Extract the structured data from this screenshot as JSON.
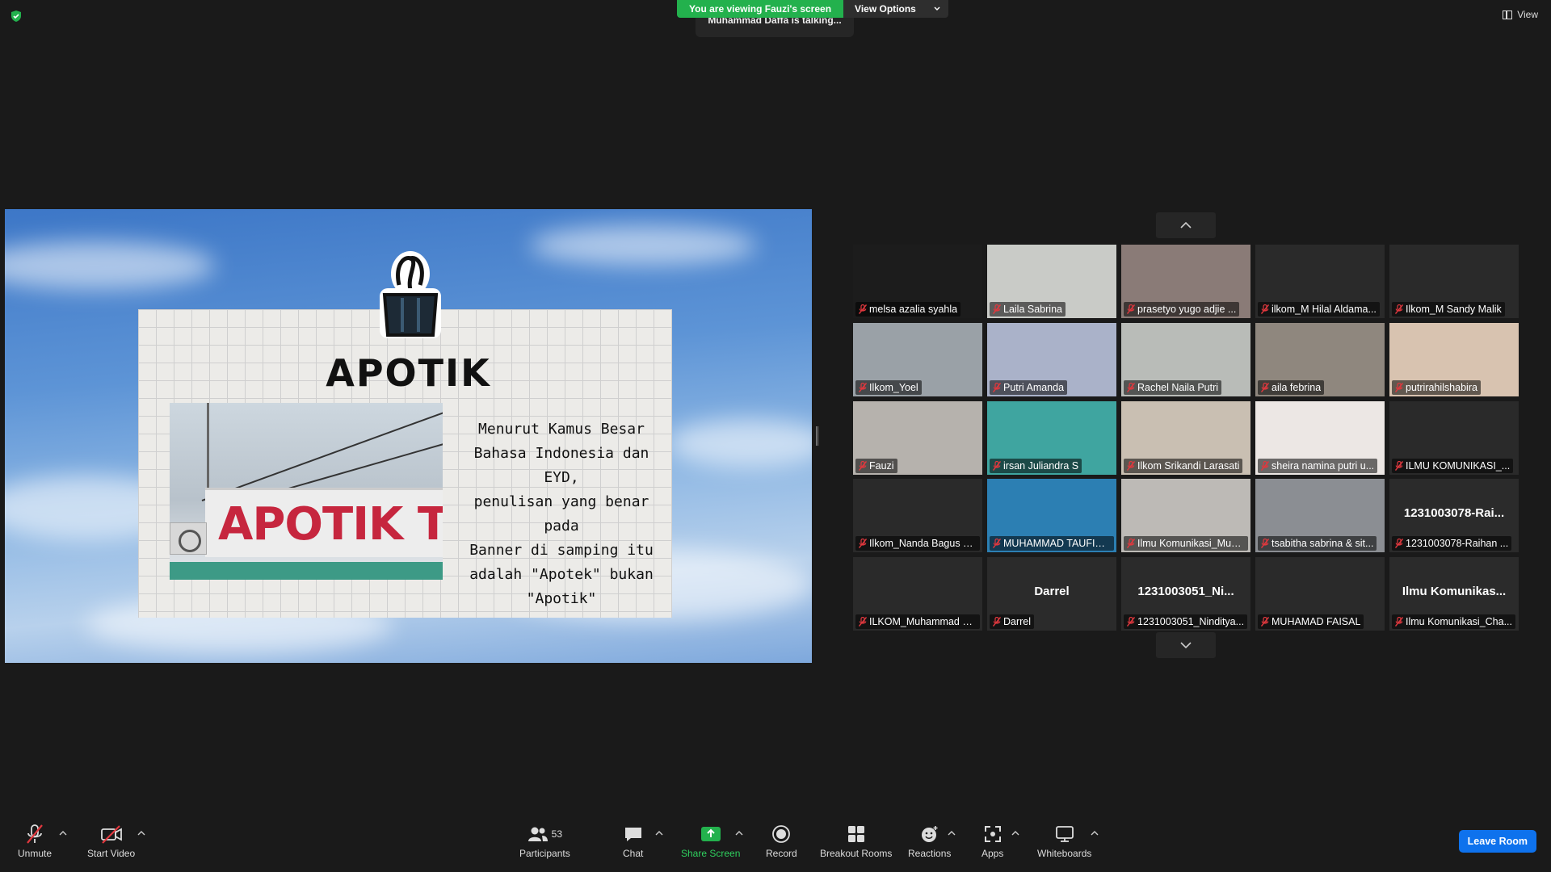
{
  "top": {
    "viewing_banner": "You are viewing Fauzi's screen",
    "view_options": "View Options",
    "talking": "Muhammad Daffa is talking...",
    "view_label": "View"
  },
  "slide": {
    "title": "APOTIK",
    "photo_banner_text": "APOTIK TAN",
    "body_lines": [
      "Menurut Kamus Besar",
      "Bahasa Indonesia dan EYD,",
      "penulisan yang benar pada",
      "Banner di samping itu",
      "adalah \"Apotek\" bukan",
      "\"Apotik\""
    ]
  },
  "gallery": {
    "tiles": [
      {
        "name": "melsa azalia syahla",
        "bg": "#1c1c1c",
        "kind": "video"
      },
      {
        "name": "Laila Sabrina",
        "bg": "#c9cbc7",
        "kind": "video"
      },
      {
        "name": "prasetyo yugo adjie ...",
        "bg": "#8a7b77",
        "kind": "video"
      },
      {
        "name": "ilkom_M Hilal Aldama...",
        "bg": "#2a2a2a",
        "kind": "video"
      },
      {
        "name": "Ilkom_M Sandy Malik",
        "bg": "#2a2a2a",
        "kind": "video"
      },
      {
        "name": "Ilkom_Yoel",
        "bg": "#9aa1a7",
        "kind": "video"
      },
      {
        "name": "Putri Amanda",
        "bg": "#aab2c9",
        "kind": "video"
      },
      {
        "name": "Rachel Naila Putri",
        "bg": "#b9bcb8",
        "kind": "video"
      },
      {
        "name": "aila febrina",
        "bg": "#8f877e",
        "kind": "video"
      },
      {
        "name": "putrirahilshabira",
        "bg": "#d8c3b0",
        "kind": "video"
      },
      {
        "name": "Fauzi",
        "bg": "#b6b2ad",
        "kind": "video"
      },
      {
        "name": "irsan Juliandra S",
        "bg": "#3fa5a0",
        "kind": "video"
      },
      {
        "name": "Ilkom Srikandi Larasati",
        "bg": "#c9bfb2",
        "kind": "video"
      },
      {
        "name": "sheira namina putri u...",
        "bg": "#ece7e4",
        "kind": "video"
      },
      {
        "name": "ILMU KOMUNIKASI_...",
        "bg": "#2a2a2a",
        "kind": "video"
      },
      {
        "name": "Ilkom_Nanda Bagus S...",
        "bg": "#2a2a2a",
        "kind": "video"
      },
      {
        "name": "MUHAMMAD TAUFIQ...",
        "bg": "#2c7fb3",
        "kind": "video"
      },
      {
        "name": "Ilmu Komunikasi_Muh...",
        "bg": "#bdbab6",
        "kind": "video"
      },
      {
        "name": "tsabitha sabrina & sit...",
        "bg": "#8b8e93",
        "kind": "video"
      },
      {
        "name": "1231003078-Raihan ...",
        "bg": "#2b2b2b",
        "kind": "name",
        "display": "1231003078-Rai..."
      },
      {
        "name": "ILKOM_Muhammad D...",
        "bg": "#2a2a2a",
        "kind": "video"
      },
      {
        "name": "Darrel",
        "bg": "#2b2b2b",
        "kind": "name",
        "display": "Darrel"
      },
      {
        "name": "1231003051_Ninditya...",
        "bg": "#2b2b2b",
        "kind": "name",
        "display": "1231003051_Ni..."
      },
      {
        "name": "MUHAMAD FAISAL",
        "bg": "#2a2a2a",
        "kind": "video"
      },
      {
        "name": "Ilmu Komunikasi_Cha...",
        "bg": "#2b2b2b",
        "kind": "name",
        "display": "Ilmu Komunikas..."
      }
    ]
  },
  "toolbar": {
    "unmute": "Unmute",
    "start_video": "Start Video",
    "participants": "Participants",
    "participants_count": "53",
    "chat": "Chat",
    "share_screen": "Share Screen",
    "record": "Record",
    "breakout_rooms": "Breakout Rooms",
    "reactions": "Reactions",
    "apps": "Apps",
    "whiteboards": "Whiteboards",
    "leave": "Leave Room"
  },
  "colors": {
    "accent_green": "#23b14d",
    "leave_blue": "#0e72ed",
    "mute_red": "#e0383e"
  }
}
